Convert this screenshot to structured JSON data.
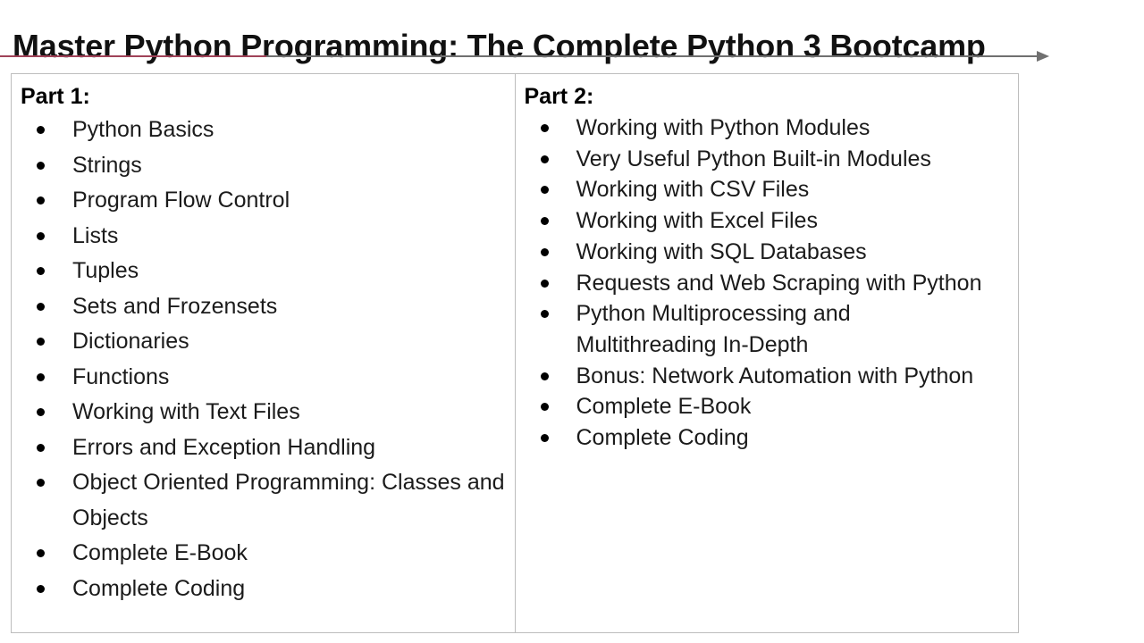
{
  "slide": {
    "title": "Master Python Programming: The Complete Python 3 Bootcamp",
    "accent_color": "#a04258",
    "rule_color": "#707070",
    "border_color": "#bdbdbd",
    "background": "#ffffff",
    "text_color": "#1b1b1b"
  },
  "columns": [
    {
      "heading": "Part 1:",
      "items": [
        "Python Basics",
        "Strings",
        "Program Flow Control",
        "Lists",
        "Tuples",
        "Sets and Frozensets",
        "Dictionaries",
        "Functions",
        "Working with Text Files",
        "Errors and Exception Handling",
        "Object Oriented Programming: Classes and Objects",
        "Complete E-Book",
        "Complete Coding"
      ]
    },
    {
      "heading": "Part 2:",
      "items": [
        "Working with Python Modules",
        "Very Useful Python Built-in Modules",
        "Working with CSV Files",
        "Working with Excel Files",
        "Working with SQL Databases",
        "Requests and Web Scraping with Python",
        "Python Multiprocessing and Multithreading In-Depth",
        "Bonus: Network Automation with Python",
        "Complete E-Book",
        "Complete Coding"
      ]
    }
  ]
}
